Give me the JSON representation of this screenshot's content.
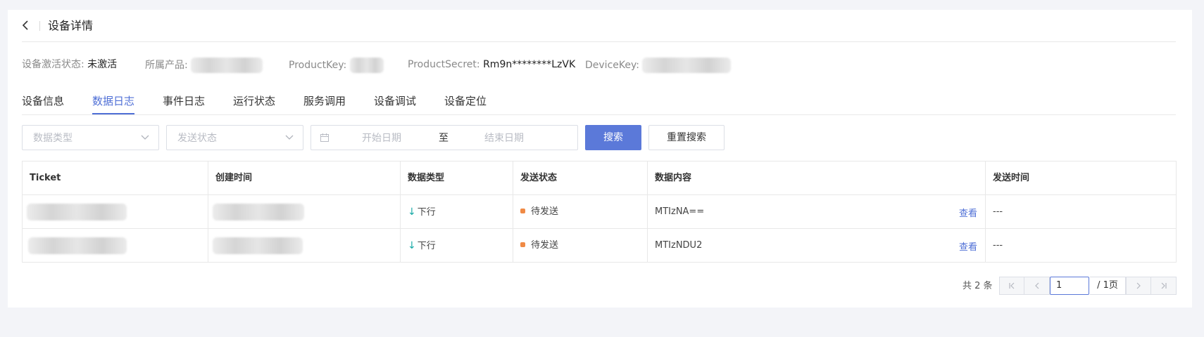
{
  "header": {
    "back_icon": "chevron-left-icon",
    "title": "设备详情"
  },
  "info": {
    "activation_label": "设备激活状态:",
    "activation_value": "未激活",
    "product_label": "所属产品:",
    "productkey_label": "ProductKey:",
    "productsecret_label": "ProductSecret:",
    "productsecret_value": "Rm9n********LzVK",
    "devicekey_label": "DeviceKey:"
  },
  "tabs": [
    {
      "label": "设备信息",
      "active": false
    },
    {
      "label": "数据日志",
      "active": true
    },
    {
      "label": "事件日志",
      "active": false
    },
    {
      "label": "运行状态",
      "active": false
    },
    {
      "label": "服务调用",
      "active": false
    },
    {
      "label": "设备调试",
      "active": false
    },
    {
      "label": "设备定位",
      "active": false
    }
  ],
  "filters": {
    "data_type_placeholder": "数据类型",
    "send_status_placeholder": "发送状态",
    "start_date_placeholder": "开始日期",
    "date_separator": "至",
    "end_date_placeholder": "结束日期",
    "search_label": "搜索",
    "reset_label": "重置搜索"
  },
  "table": {
    "columns": [
      "Ticket",
      "创建时间",
      "数据类型",
      "发送状态",
      "数据内容",
      "发送时间"
    ],
    "rows": [
      {
        "data_type": "下行",
        "status": "待发送",
        "content": "MTIzNA==",
        "view": "查看",
        "send_time": "---"
      },
      {
        "data_type": "下行",
        "status": "待发送",
        "content": "MTIzNDU2",
        "view": "查看",
        "send_time": "---"
      }
    ],
    "status_color": "#f08a45",
    "direction_color": "#17a9a6"
  },
  "pagination": {
    "total_text": "共 2 条",
    "current_page": "1",
    "total_pages_text": "/ 1页"
  },
  "colors": {
    "accent": "#4f6fd6",
    "primary_button": "#5b79d9",
    "page_bg": "#f3f4f8"
  }
}
